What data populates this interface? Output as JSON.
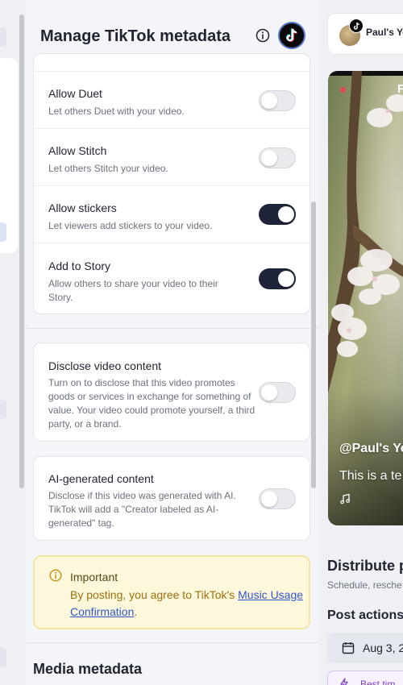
{
  "panel": {
    "title": "Manage TikTok metadata"
  },
  "settings": [
    {
      "key": "duet",
      "title": "Allow Duet",
      "description": "Let others Duet with your video.",
      "enabled": false
    },
    {
      "key": "stitch",
      "title": "Allow Stitch",
      "description": "Let others Stitch your video.",
      "enabled": false
    },
    {
      "key": "stickers",
      "title": "Allow stickers",
      "description": "Let viewers add stickers to your video.",
      "enabled": true
    },
    {
      "key": "story",
      "title": "Add to Story",
      "description": "Allow others to share your video to their Story.",
      "enabled": true
    }
  ],
  "disclose": {
    "title": "Disclose video content",
    "description": "Turn on to disclose that this video promotes goods or services in exchange for something of value. Your video could promote yourself, a third party, or a brand.",
    "enabled": false
  },
  "ai_content": {
    "title": "AI-generated content",
    "description": "Disclose if this video was generated with AI. TikTok will add a \"Creator labeled as AI-generated\" tag.",
    "enabled": false
  },
  "notice": {
    "title": "Important",
    "body_prefix": "By posting, you agree to TikTok's ",
    "link": "Music Usage Confirmation",
    "body_suffix": "."
  },
  "media_section": {
    "title": "Media metadata"
  },
  "account": {
    "name": "Paul's Yo"
  },
  "preview": {
    "handle": "@Paul's Yo",
    "caption": "This is a te",
    "top_letter": "F"
  },
  "distribute": {
    "title": "Distribute p",
    "subtitle": "Schedule, resche"
  },
  "post_actions": {
    "title": "Post actions",
    "date": "Aug 3, 2",
    "best_time": "Best tim"
  },
  "colors": {
    "toggle_on": "#1e2538",
    "toggle_off": "#e8eaee",
    "notice_bg": "#fdf8dc",
    "notice_text": "#a0700a",
    "link": "#2f57c9"
  }
}
